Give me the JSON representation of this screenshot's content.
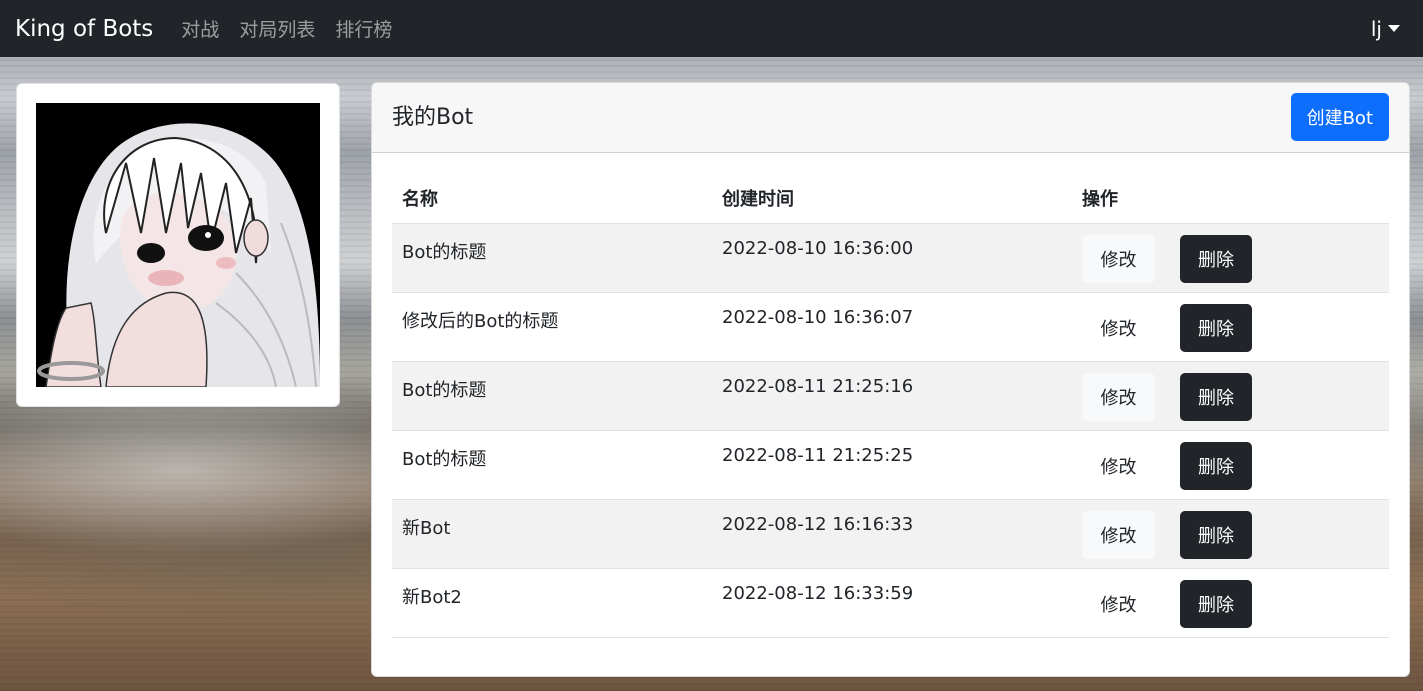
{
  "navbar": {
    "brand": "King of Bots",
    "links": [
      "对战",
      "对局列表",
      "排行榜"
    ],
    "user": "lj"
  },
  "profile": {
    "avatar_icon": "avatar-illustration"
  },
  "bots": {
    "title": "我的Bot",
    "create_label": "创建Bot",
    "columns": [
      "名称",
      "创建时间",
      "操作"
    ],
    "edit_label": "修改",
    "delete_label": "删除",
    "rows": [
      {
        "name": "Bot的标题",
        "created": "2022-08-10 16:36:00"
      },
      {
        "name": "修改后的Bot的标题",
        "created": "2022-08-10 16:36:07"
      },
      {
        "name": "Bot的标题",
        "created": "2022-08-11 21:25:16"
      },
      {
        "name": "Bot的标题",
        "created": "2022-08-11 21:25:25"
      },
      {
        "name": "新Bot",
        "created": "2022-08-12 16:16:33"
      },
      {
        "name": "新Bot2",
        "created": "2022-08-12 16:33:59"
      }
    ]
  },
  "colors": {
    "navbar_bg": "#212529",
    "primary": "#0d6efd",
    "dark_button": "#212529"
  }
}
